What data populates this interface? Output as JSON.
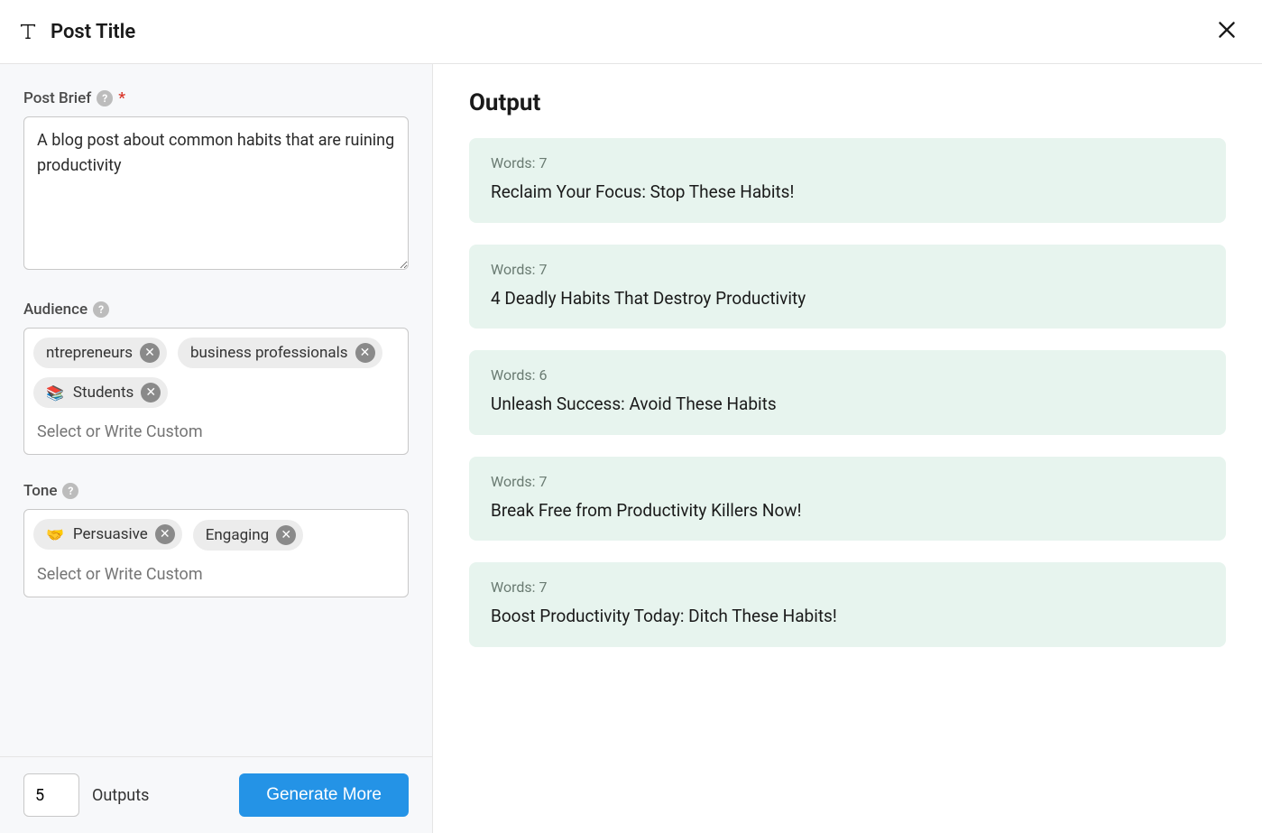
{
  "header": {
    "title": "Post Title"
  },
  "form": {
    "post_brief": {
      "label": "Post Brief",
      "value": "A blog post about common habits that are ruining productivity"
    },
    "audience": {
      "label": "Audience",
      "placeholder": "Select or Write Custom",
      "tags": [
        {
          "label": "ntrepreneurs",
          "emoji": ""
        },
        {
          "label": "business professionals",
          "emoji": ""
        },
        {
          "label": "Students",
          "emoji": "📚"
        }
      ]
    },
    "tone": {
      "label": "Tone",
      "placeholder": "Select or Write Custom",
      "tags": [
        {
          "label": "Persuasive",
          "emoji": "🤝"
        },
        {
          "label": "Engaging",
          "emoji": ""
        }
      ]
    },
    "outputs_count": "5",
    "outputs_label": "Outputs",
    "generate_label": "Generate More"
  },
  "output": {
    "title": "Output",
    "words_prefix": "Words: ",
    "results": [
      {
        "words": "7",
        "text": "Reclaim Your Focus: Stop These Habits!"
      },
      {
        "words": "7",
        "text": "4 Deadly Habits That Destroy Productivity"
      },
      {
        "words": "6",
        "text": "Unleash Success: Avoid These Habits"
      },
      {
        "words": "7",
        "text": "Break Free from Productivity Killers Now!"
      },
      {
        "words": "7",
        "text": "Boost Productivity Today: Ditch These Habits!"
      }
    ]
  }
}
